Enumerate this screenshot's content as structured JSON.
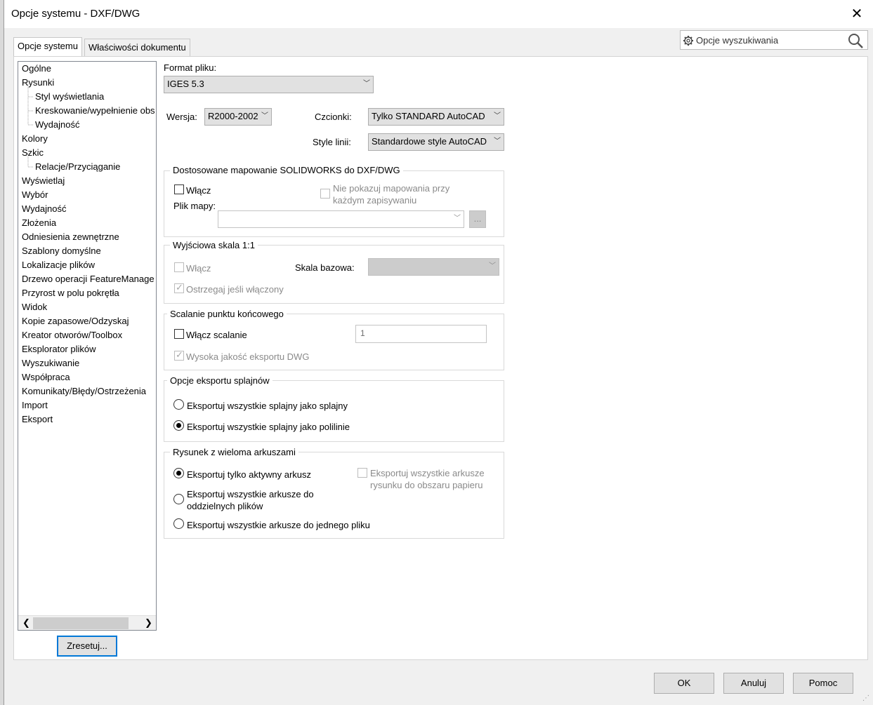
{
  "window": {
    "title": "Opcje systemu - DXF/DWG",
    "close_icon": "close-icon"
  },
  "tabs": [
    {
      "label": "Opcje systemu"
    },
    {
      "label": "Właściwości dokumentu"
    }
  ],
  "search": {
    "placeholder": "Opcje wyszukiwania",
    "gear_icon": "gear-icon",
    "search_icon": "search-icon"
  },
  "tree": {
    "items": [
      {
        "label": "Ogólne"
      },
      {
        "label": "Rysunki"
      },
      {
        "label": "Styl wyświetlania"
      },
      {
        "label": "Kreskowanie/wypełnienie obs"
      },
      {
        "label": "Wydajność"
      },
      {
        "label": "Kolory"
      },
      {
        "label": "Szkic"
      },
      {
        "label": "Relacje/Przyciąganie"
      },
      {
        "label": "Wyświetlaj"
      },
      {
        "label": "Wybór"
      },
      {
        "label": "Wydajność"
      },
      {
        "label": "Złożenia"
      },
      {
        "label": "Odniesienia zewnętrzne"
      },
      {
        "label": "Szablony domyślne"
      },
      {
        "label": "Lokalizacje plików"
      },
      {
        "label": "Drzewo operacji FeatureManage"
      },
      {
        "label": "Przyrost w polu pokrętła"
      },
      {
        "label": "Widok"
      },
      {
        "label": "Kopie zapasowe/Odzyskaj"
      },
      {
        "label": "Kreator otworów/Toolbox"
      },
      {
        "label": "Eksplorator plików"
      },
      {
        "label": "Wyszukiwanie"
      },
      {
        "label": "Współpraca"
      },
      {
        "label": "Komunikaty/Błędy/Ostrzeżenia"
      },
      {
        "label": "Import"
      },
      {
        "label": "Eksport"
      }
    ]
  },
  "reset_button": "Zresetuj...",
  "format": {
    "label": "Format pliku:",
    "value": "IGES 5.3"
  },
  "version": {
    "label": "Wersja:",
    "value": "R2000-2002"
  },
  "fonts": {
    "label": "Czcionki:",
    "value": "Tylko STANDARD AutoCAD"
  },
  "line_styles": {
    "label": "Style linii:",
    "value": "Standardowe style AutoCAD"
  },
  "mapping": {
    "legend": "Dostosowane mapowanie SOLIDWORKS do DXF/DWG",
    "enable": "Włącz",
    "no_show_line1": "Nie pokazuj mapowania przy",
    "no_show_line2": "każdym zapisywaniu",
    "map_file_label": "Plik mapy:",
    "map_file_value": "",
    "browse": "..."
  },
  "scale": {
    "legend": "Wyjściowa skala 1:1",
    "enable": "Włącz",
    "base_label": "Skala bazowa:",
    "base_value": "",
    "warn": "Ostrzegaj jeśli włączony"
  },
  "merge": {
    "legend": "Scalanie punktu końcowego",
    "enable": "Włącz scalanie",
    "value": "1",
    "high_quality": "Wysoka jakość eksportu DWG"
  },
  "splines": {
    "legend": "Opcje eksportu splajnów",
    "opt1": "Eksportuj wszystkie splajny jako splajny",
    "opt2": "Eksportuj wszystkie splajny jako polilinie",
    "selected": 2
  },
  "sheets": {
    "legend": "Rysunek z wieloma arkuszami",
    "opt1": "Eksportuj tylko aktywny arkusz",
    "opt2_line1": "Eksportuj wszystkie arkusze do",
    "opt2_line2": "oddzielnych plików",
    "opt3": "Eksportuj wszystkie arkusze do jednego pliku",
    "paper_line1": "Eksportuj wszystkie arkusze",
    "paper_line2": "rysunku do obszaru papieru",
    "selected": 1
  },
  "footer": {
    "ok": "OK",
    "cancel": "Anuluj",
    "help": "Pomoc"
  },
  "colors": {
    "panel_bg": "#ffffff",
    "dialog_bg": "#f0f0f0",
    "focus_border": "#0078d7",
    "disabled_text": "#8a8a8a"
  }
}
